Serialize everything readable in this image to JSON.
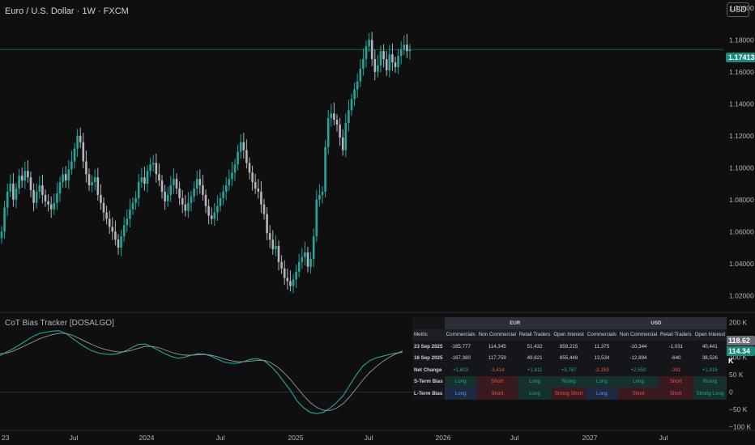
{
  "header": {
    "title": "Euro / U.S. Dollar · 1W · FXCM",
    "currency_button": "USD"
  },
  "indicator": {
    "title": "CoT Bias Tracker [DOSALGO]"
  },
  "colors": {
    "up": "#26a69a",
    "down": "#b2b5be",
    "line_main": "#26a69a",
    "line_signal": "#9598a1",
    "price_line": "#1e5c57"
  },
  "chart_data": [
    {
      "type": "candlestick",
      "title": "Euro / U.S. Dollar · 1W · FXCM",
      "ylim": [
        1.01,
        1.205
      ],
      "y_ticks": [
        "1.20000",
        "1.18000",
        "1.16000",
        "1.14000",
        "1.12000",
        "1.10000",
        "1.08000",
        "1.06000",
        "1.04000",
        "1.02000"
      ],
      "last_price": "1.17413",
      "closes": [
        1.06,
        1.075,
        1.085,
        1.09,
        1.08,
        1.087,
        1.095,
        1.092,
        1.098,
        1.094,
        1.086,
        1.078,
        1.085,
        1.089,
        1.083,
        1.079,
        1.077,
        1.074,
        1.078,
        1.084,
        1.091,
        1.096,
        1.092,
        1.099,
        1.104,
        1.112,
        1.12,
        1.116,
        1.104,
        1.096,
        1.089,
        1.091,
        1.094,
        1.083,
        1.078,
        1.072,
        1.068,
        1.063,
        1.06,
        1.055,
        1.05,
        1.057,
        1.064,
        1.068,
        1.074,
        1.078,
        1.081,
        1.091,
        1.094,
        1.09,
        1.098,
        1.102,
        1.103,
        1.096,
        1.092,
        1.085,
        1.079,
        1.083,
        1.089,
        1.093,
        1.087,
        1.081,
        1.077,
        1.073,
        1.078,
        1.082,
        1.087,
        1.093,
        1.089,
        1.083,
        1.076,
        1.07,
        1.068,
        1.072,
        1.076,
        1.081,
        1.085,
        1.089,
        1.093,
        1.097,
        1.102,
        1.11,
        1.116,
        1.111,
        1.103,
        1.097,
        1.091,
        1.087,
        1.085,
        1.077,
        1.071,
        1.059,
        1.055,
        1.049,
        1.051,
        1.041,
        1.037,
        1.031,
        1.029,
        1.026,
        1.03,
        1.035,
        1.041,
        1.044,
        1.047,
        1.038,
        1.043,
        1.057,
        1.08,
        1.083,
        1.085,
        1.113,
        1.131,
        1.134,
        1.13,
        1.127,
        1.119,
        1.111,
        1.128,
        1.136,
        1.143,
        1.149,
        1.154,
        1.162,
        1.168,
        1.176,
        1.18,
        1.168,
        1.16,
        1.164,
        1.173,
        1.168,
        1.161,
        1.171,
        1.166,
        1.163,
        1.17,
        1.174,
        1.177,
        1.173,
        1.174
      ]
    },
    {
      "type": "line",
      "title": "CoT Bias Tracker [DOSALGO]",
      "ylim": [
        -110000,
        215000
      ],
      "y_ticks": [
        "200 K",
        "150 K",
        "100 K",
        "50 K",
        "0",
        "−50 K",
        "−100 K"
      ],
      "series": [
        {
          "values": [
            105000,
            115000,
            125000,
            136000,
            148000,
            160000,
            168000,
            172000,
            175000,
            176000,
            168000,
            154000,
            140000,
            128000,
            118000,
            112000,
            109000,
            108000,
            111000,
            118000,
            128000,
            137000,
            138000,
            130000,
            120000,
            110000,
            102000,
            97000,
            100000,
            106000,
            110000,
            109000,
            103000,
            94000,
            86000,
            83000,
            83000,
            88000,
            94000,
            96000,
            90000,
            75000,
            55000,
            30000,
            5000,
            -25000,
            -45000,
            -58000,
            -62000,
            -58000,
            -46000,
            -30000,
            -10000,
            20000,
            50000,
            75000,
            90000,
            98000,
            103000,
            108000,
            112000,
            114340
          ]
        },
        {
          "values": [
            110000,
            112000,
            118000,
            126000,
            135000,
            144000,
            153000,
            160000,
            165000,
            169000,
            168000,
            163000,
            154000,
            145000,
            136000,
            128000,
            122000,
            118000,
            115000,
            116000,
            120000,
            126000,
            131000,
            131000,
            128000,
            121000,
            114000,
            109000,
            106000,
            106000,
            107000,
            108000,
            106000,
            101000,
            95000,
            90000,
            87000,
            87000,
            89000,
            91000,
            91000,
            85000,
            73000,
            56000,
            36000,
            13000,
            -10000,
            -30000,
            -44000,
            -52000,
            -53000,
            -46000,
            -33000,
            -13000,
            11000,
            35000,
            56000,
            73000,
            88000,
            100000,
            110000,
            118620
          ]
        }
      ],
      "last_values": [
        "118.62 K",
        "114.34 K"
      ]
    }
  ],
  "x_axis": {
    "labels": [
      "23",
      "Jul",
      "2024",
      "Jul",
      "2025",
      "Jul",
      "2026",
      "Jul",
      "2027",
      "Jul"
    ]
  },
  "table": {
    "groups": [
      "EUR",
      "USD"
    ],
    "columns": [
      "Metric",
      "Commercials",
      "Non Commercial",
      "Retail Traders",
      "Open Interest",
      "Commercials",
      "Non Commercial",
      "Retail Traders",
      "Open Interest"
    ],
    "rows": [
      {
        "label": "23 Sep 2025",
        "cells": [
          "-165,777",
          "114,345",
          "51,432",
          "859,215",
          "11,375",
          "-10,344",
          "-1,031",
          "40,441"
        ],
        "tones": [
          "",
          "",
          "",
          "",
          "",
          "",
          "",
          ""
        ]
      },
      {
        "label": "16 Sep 2025",
        "cells": [
          "-167,380",
          "117,759",
          "49,621",
          "855,448",
          "13,534",
          "-12,894",
          "-640",
          "38,526"
        ],
        "tones": [
          "",
          "",
          "",
          "",
          "",
          "",
          "",
          ""
        ]
      },
      {
        "label": "Net Change",
        "cells": [
          "+1,603",
          "-3,414",
          "+1,811",
          "+3,767",
          "-2,159",
          "+2,550",
          "-391",
          "+1,915"
        ],
        "tones": [
          "pos",
          "neg",
          "pos",
          "pos",
          "neg",
          "pos",
          "neg",
          "pos"
        ]
      },
      {
        "label": "S-Term Bias",
        "cells": [
          "Long",
          "Short",
          "Long",
          "Rising",
          "Long",
          "Long",
          "Short",
          "Rising"
        ],
        "tones": [
          "c-pos",
          "c-neg",
          "c-pos",
          "c-pos",
          "c-pos",
          "c-pos",
          "c-neg",
          "c-pos"
        ]
      },
      {
        "label": "L-Term Bias",
        "cells": [
          "Long",
          "Short",
          "Long",
          "Strong Short",
          "Long",
          "Short",
          "Short",
          "Strong Long"
        ],
        "tones": [
          "c-blu",
          "c-neg",
          "c-pos",
          "c-neg",
          "c-blu",
          "c-neg",
          "c-neg",
          "c-pos"
        ]
      }
    ]
  }
}
